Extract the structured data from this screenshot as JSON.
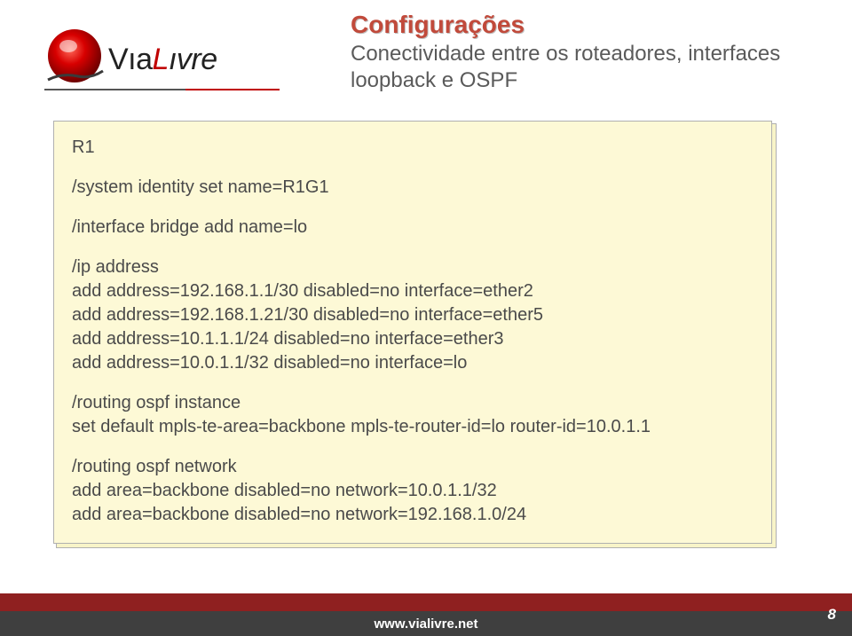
{
  "logo": {
    "brand_via": "Vıa",
    "brand_l": "L",
    "brand_ivre": "ıvre"
  },
  "header": {
    "title": "Configurações",
    "subtitle": "Conectividade entre os roteadores, interfaces loopback e OSPF"
  },
  "config": {
    "router": "R1",
    "identity": "/system identity set name=R1G1",
    "bridge": "/interface bridge add name=lo",
    "ip_header": "/ip address",
    "ip_lines": [
      "add address=192.168.1.1/30 disabled=no interface=ether2",
      "add address=192.168.1.21/30 disabled=no interface=ether5",
      "add address=10.1.1.1/24 disabled=no interface=ether3",
      "add address=10.0.1.1/32 disabled=no interface=lo"
    ],
    "ospf_instance_header": "/routing ospf instance",
    "ospf_instance_line": "set default mpls-te-area=backbone mpls-te-router-id=lo router-id=10.0.1.1",
    "ospf_network_header": "/routing ospf network",
    "ospf_network_lines": [
      "add area=backbone disabled=no network=10.0.1.1/32",
      "add area=backbone disabled=no network=192.168.1.0/24"
    ]
  },
  "footer": {
    "url": "www.vialivre.net",
    "page": "8"
  }
}
